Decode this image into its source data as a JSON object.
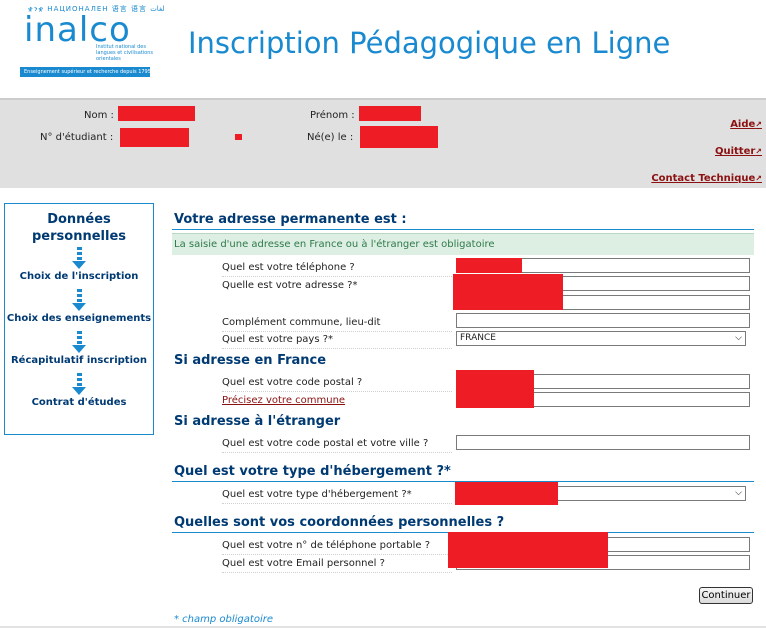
{
  "logo": {
    "scripts": "ቋንቋ НАЦИОНАЛЕН 语言 语言 لغات",
    "name": "inalco",
    "subtitle": "Institut national des langues et civilisations orientales",
    "band": "Enseignement supérieur et recherche depuis 1795"
  },
  "header": {
    "title": "Inscription Pédagogique en Ligne"
  },
  "identity": {
    "nom_label": "Nom :",
    "prenom_label": "Prénom :",
    "numero_label": "N° d'étudiant :",
    "naissance_label": "Né(e) le :"
  },
  "toplinks": {
    "aide": "Aide",
    "quitter": "Quitter",
    "contact": "Contact Technique",
    "arrow": "↗"
  },
  "steps": {
    "current": "Données personnelles",
    "items": [
      "Choix de l'inscription",
      "Choix des enseignements",
      "Récapitulatif inscription",
      "Contrat d'études"
    ]
  },
  "form": {
    "address_title": "Votre adresse permanente est :",
    "notice": "La saisie d'une adresse en France ou à l'étranger est obligatoire",
    "phone_label": "Quel est votre téléphone ?",
    "address_label": "Quelle est votre adresse ?*",
    "complement_label": "Complément commune, lieu-dit",
    "country_label": "Quel est votre pays ?*",
    "country_value": "FRANCE",
    "france_title": "Si adresse en France",
    "postal_label": "Quel est votre code postal ?",
    "commune_label": "Précisez votre commune",
    "foreign_title": "Si adresse à l'étranger",
    "foreign_label": "Quel est votre code postal et votre ville ?",
    "housing_title": "Quel est votre type d'hébergement ?*",
    "housing_label": "Quel est votre type d'hébergement ?*",
    "contact_title": "Quelles sont vos coordonnées personnelles ?",
    "mobile_label": "Quel est votre n° de téléphone portable ?",
    "email_label": "Quel est votre Email personnel ?",
    "continue_label": "Continuer",
    "mandatory_note": "* champ obligatoire"
  },
  "icons": {
    "select_arrow": "chevron-down-icon",
    "step_arrow": "arrow-down-icon"
  },
  "colors": {
    "accent": "#1a8ad0",
    "heading": "#003a73",
    "link": "#8b1010",
    "redaction": "#ee1c25",
    "notice_bg": "#ddeee2"
  }
}
